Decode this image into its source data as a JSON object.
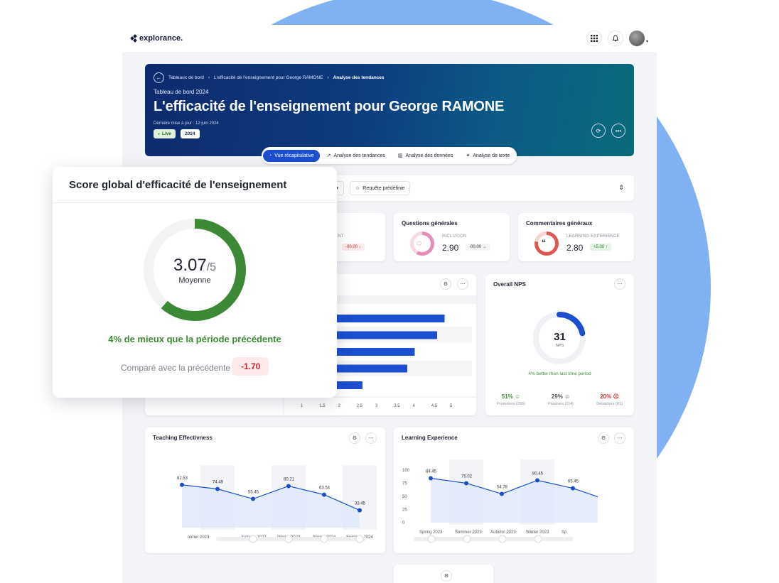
{
  "brand": {
    "name": "explorance."
  },
  "topbar": {
    "icons": [
      "apps-grid-icon",
      "bell-icon",
      "user-avatar"
    ]
  },
  "breadcrumbs": [
    "Tableaux de bord",
    "L'efficacité de l'enseignement pour George RAMONE",
    "Analyse des tendances"
  ],
  "hero": {
    "supertitle": "Tableau de bord 2024",
    "title": "L'efficacité de l'enseignement pour George RAMONE",
    "updated": "Dernière mise à jour : 12 juin 2024",
    "status": "Live",
    "year": "2024"
  },
  "tabs": [
    {
      "label": "Vue récapitulative",
      "active": true
    },
    {
      "label": "Analyse des tendances",
      "active": false
    },
    {
      "label": "Analyse des données",
      "active": false
    },
    {
      "label": "Analyse de texte",
      "active": false
    }
  ],
  "filters": {
    "predefined": "Requête prédéfinie"
  },
  "kpis": [
    {
      "title": "",
      "label": "MENT",
      "delta": "-00.00 ↓"
    },
    {
      "title": "Questions générales",
      "label": "INCLUSION",
      "value": "2.90",
      "delta": "-00.00 →"
    },
    {
      "title": "Commentaires généraux",
      "label": "LEARNING EXPERIENCE",
      "value": "2.80",
      "delta": "+5.00 ↑"
    }
  ],
  "bar_chart": {
    "type": "bar",
    "orientation": "horizontal",
    "values": [
      4.8,
      4.6,
      4.0,
      3.8,
      2.6
    ],
    "xticks": [
      "1",
      "1.5",
      "2",
      "2.5",
      "3",
      "3.5",
      "4",
      "4.5",
      "5"
    ],
    "xlim": [
      1,
      5
    ],
    "color": "#1b4fcf"
  },
  "nps": {
    "title": "Overall NPS",
    "value": "31",
    "unit": "NPS",
    "fraction": 0.31,
    "caption": "4% better then last time period",
    "promoters": {
      "pct": "51%",
      "label": "Promoters (206)"
    },
    "passives": {
      "pct": "29%",
      "label": "Passives (114)"
    },
    "detractors": {
      "pct": "20%",
      "label": "Detractors (81)"
    }
  },
  "chart_data": [
    {
      "type": "line",
      "title": "Teaching Effectivness",
      "categories": [
        "Summer 2023",
        "Automn 2023",
        "Winter 2023",
        "Spring 2024",
        "Summer 2024"
      ],
      "visible_category_text": [
        "mmer 2023",
        "Automn 2023",
        "Winter 2023",
        "Spring 2024",
        "Summer 2024"
      ],
      "values": [
        82.53,
        74.49,
        55.45,
        80.21,
        63.54,
        33.45
      ],
      "ylim": [
        0,
        100
      ],
      "color": "#1b4fcf"
    },
    {
      "type": "line",
      "title": "Learning Experience",
      "categories": [
        "Spring 2023",
        "Summer 2023",
        "Automn 2023",
        "Winter 2023",
        "Sp"
      ],
      "values": [
        84.45,
        75.02,
        54.78,
        80.45,
        65.45
      ],
      "yticks": [
        "100",
        "75",
        "50",
        "25",
        "0"
      ],
      "ylim": [
        0,
        100
      ],
      "color": "#1b4fcf"
    }
  ],
  "overlay": {
    "title": "Score global d'efficacité de l'enseignement",
    "score": "3.07",
    "max": "/5",
    "label": "Moyenne",
    "fraction": 0.614,
    "caption": "4% de mieux que la période précédente",
    "compare_label": "Comparé avec la précédente",
    "compare_value": "-1.70",
    "color": "#3c8a35"
  }
}
